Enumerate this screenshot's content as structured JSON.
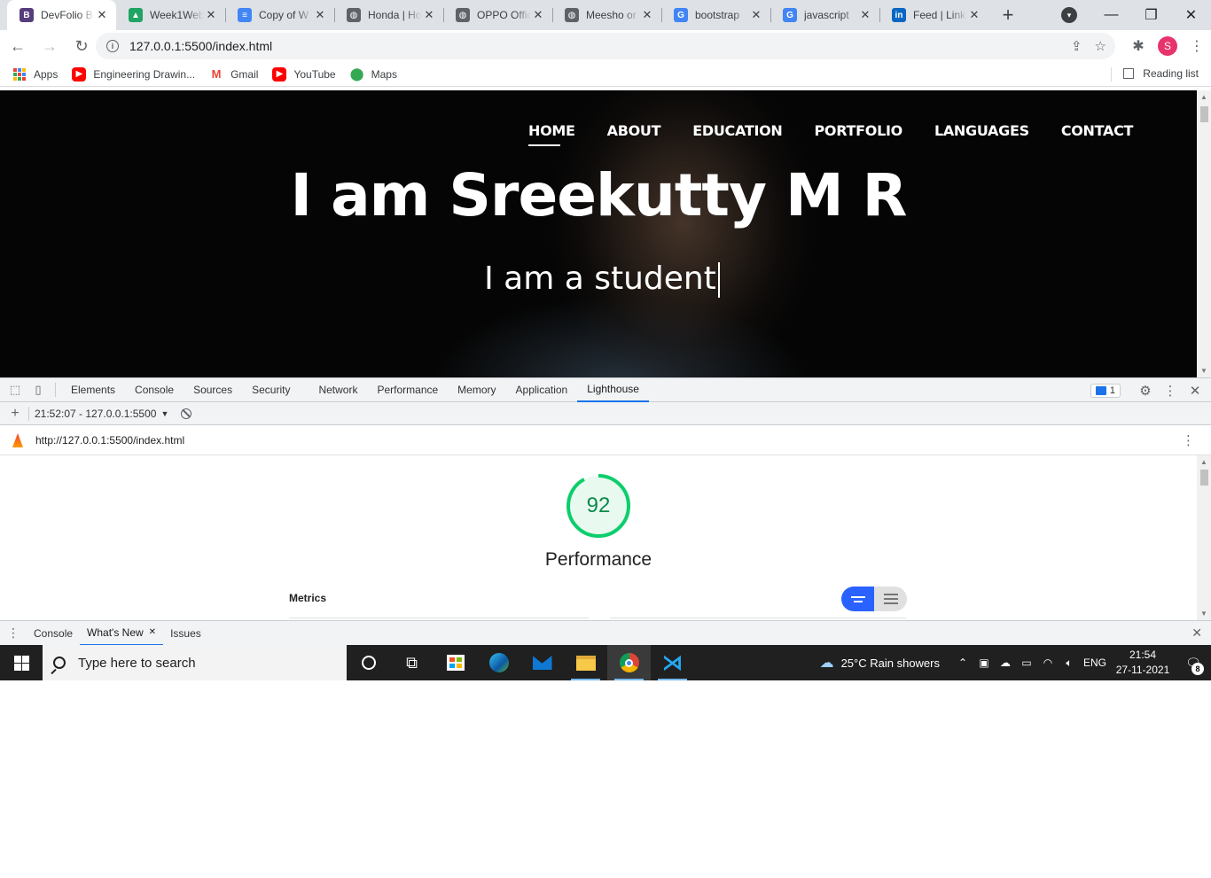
{
  "browser": {
    "tabs": [
      {
        "title": "DevFolio B",
        "fav": "B",
        "color": "#563d7c",
        "active": true
      },
      {
        "title": "Week1Web",
        "fav": "▲",
        "color": "#1fa463",
        "active": false
      },
      {
        "title": "Copy of W",
        "fav": "≡",
        "color": "#4285f4",
        "active": false
      },
      {
        "title": "Honda | Ho",
        "fav": "◍",
        "color": "#5f6368",
        "active": false
      },
      {
        "title": "OPPO Offic",
        "fav": "◍",
        "color": "#5f6368",
        "active": false
      },
      {
        "title": "Meesho or",
        "fav": "◍",
        "color": "#5f6368",
        "active": false
      },
      {
        "title": "bootstrap",
        "fav": "G",
        "color": "#4285f4",
        "active": false
      },
      {
        "title": "javascript",
        "fav": "G",
        "color": "#4285f4",
        "active": false
      },
      {
        "title": "Feed | Link",
        "fav": "in",
        "color": "#0a66c2",
        "active": false
      }
    ],
    "new_tab_label": "+",
    "url": "127.0.0.1:5500/index.html",
    "avatar_letter": "S",
    "bookmarks": [
      {
        "label": "Apps",
        "icon": "apps-grid-icon"
      },
      {
        "label": "Engineering Drawin...",
        "icon": "youtube-icon",
        "color": "#ff0000"
      },
      {
        "label": "Gmail",
        "icon": "gmail-icon",
        "color": "#ea4335"
      },
      {
        "label": "YouTube",
        "icon": "youtube-icon",
        "color": "#ff0000"
      },
      {
        "label": "Maps",
        "icon": "maps-icon",
        "color": "#34a853"
      }
    ],
    "reading_list": "Reading list"
  },
  "site": {
    "nav": [
      "HOME",
      "ABOUT",
      "EDUCATION",
      "PORTFOLIO",
      "LANGUAGES",
      "CONTACT"
    ],
    "active_nav": "HOME",
    "title": "I am Sreekutty M R",
    "subtitle": "I am a student"
  },
  "devtools": {
    "tabs": [
      "Elements",
      "Console",
      "Sources",
      "Security",
      "Network",
      "Performance",
      "Memory",
      "Application",
      "Lighthouse"
    ],
    "active_tab": "Lighthouse",
    "issues_count": "1",
    "report_select": "21:52:07 - 127.0.0.1:5500",
    "report_url": "http://127.0.0.1:5500/index.html",
    "score": "92",
    "score_fraction": 0.92,
    "score_color": "#0cce6b",
    "category": "Performance",
    "metrics_label": "Metrics",
    "drawer_tabs": [
      "Console",
      "What's New",
      "Issues"
    ],
    "active_drawer_tab": "What's New"
  },
  "taskbar": {
    "search_placeholder": "Type here to search",
    "weather": "25°C  Rain showers",
    "lang": "ENG",
    "time": "21:54",
    "date": "27-11-2021",
    "notifications": "8"
  }
}
